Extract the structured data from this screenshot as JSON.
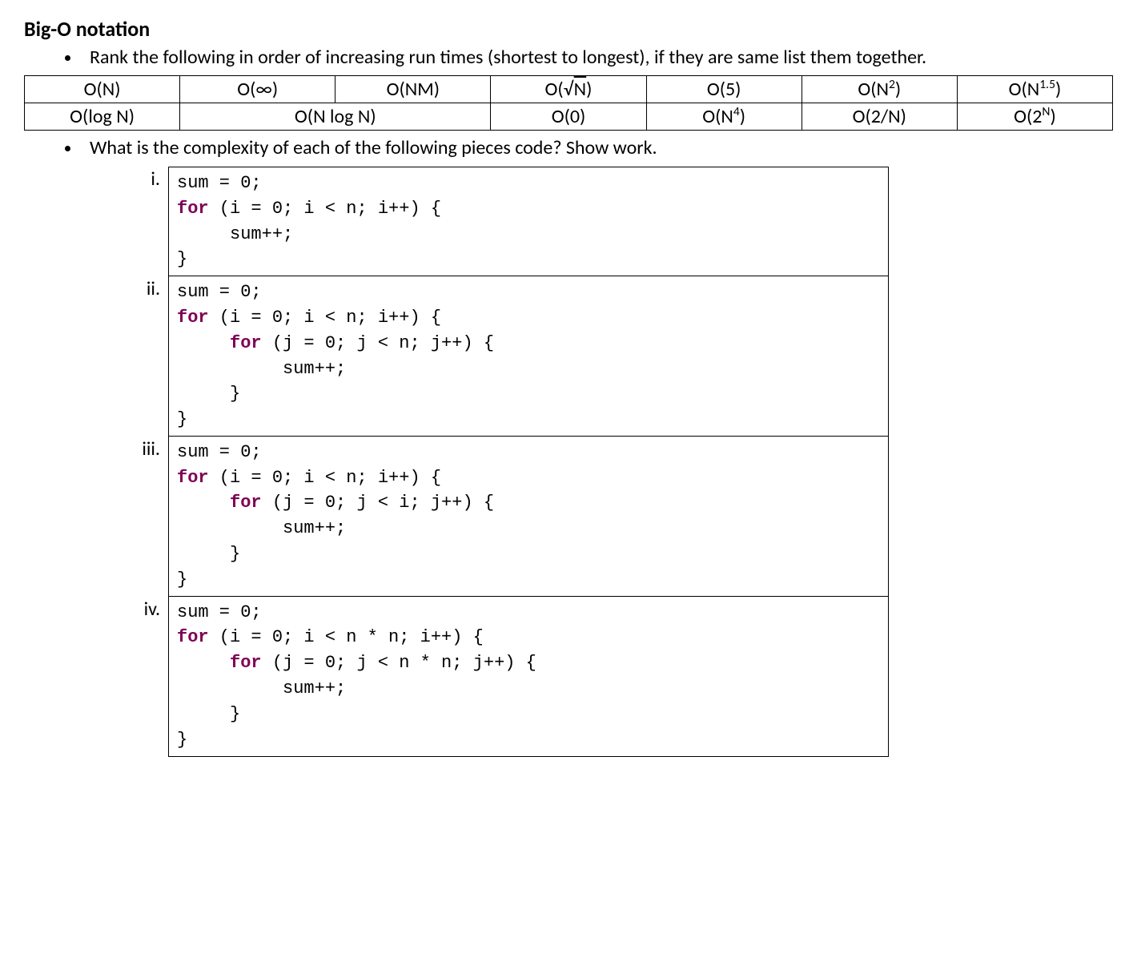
{
  "heading": "Big-O notation",
  "bullets": {
    "rank": "Rank the following in order of increasing run times (shortest to longest), if they are same list them together.",
    "complexity": "What is the complexity of each of the following pieces code? Show work."
  },
  "table": {
    "row1": {
      "c1": "O(N)",
      "c2": "O(∞)",
      "c3": "O(NM)",
      "c5": "O(5)"
    },
    "row2": {
      "c1": "O(log N)",
      "c2": "O(N log N)",
      "c4": "O(0)",
      "c7": "O(2/N)"
    }
  },
  "math": {
    "sqrtN_prefix": "O(",
    "sqrtN_rad": "√",
    "sqrtN_arg": "N",
    "sqrtN_suffix": ")",
    "N2_prefix": "O(N",
    "N2_sup": "2",
    "N2_suffix": ")",
    "N15_prefix": "O(N",
    "N15_sup": "1.5",
    "N15_suffix": ")",
    "N4_prefix": "O(N",
    "N4_sup": "4",
    "N4_suffix": ")",
    "twoN_prefix": "O(2",
    "twoN_sup": "N",
    "twoN_suffix": ")"
  },
  "labels": {
    "i": "i.",
    "ii": "ii.",
    "iii": "iii.",
    "iv": "iv."
  },
  "code": {
    "kw_for": "for",
    "i": {
      "l1": "sum = 0;",
      "l2a": " (i = 0; i < n; i++) {",
      "l3": "     sum++;",
      "l4": "}"
    },
    "ii": {
      "l1": "sum = 0;",
      "l2a": " (i = 0; i < n; i++) {",
      "l3a": " (j = 0; j < n; j++) {",
      "l4": "          sum++;",
      "l5": "     }",
      "l6": "}"
    },
    "iii": {
      "l1": "sum = 0;",
      "l2a": " (i = 0; i < n; i++) {",
      "l3a": " (j = 0; j < i; j++) {",
      "l4": "          sum++;",
      "l5": "     }",
      "l6": "}"
    },
    "iv": {
      "l1": "sum = 0;",
      "l2a": " (i = 0; i < n * n; i++) {",
      "l3a": " (j = 0; j < n * n; j++) {",
      "l4": "          sum++;",
      "l5": "     }",
      "l6": "}"
    }
  }
}
